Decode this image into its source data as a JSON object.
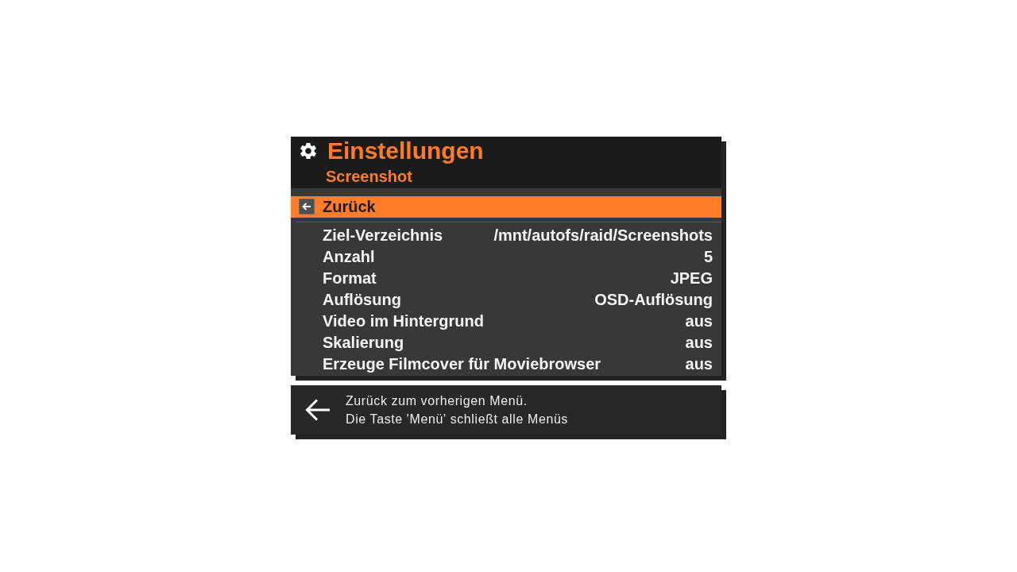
{
  "header": {
    "title": "Einstellungen",
    "subtitle": "Screenshot"
  },
  "menu": {
    "items": [
      {
        "kind": "back",
        "label": "Zurück",
        "selected": true
      },
      {
        "kind": "setting",
        "label": "Ziel-Verzeichnis",
        "value": "/mnt/autofs/raid/Screenshots",
        "selected": false
      },
      {
        "kind": "setting",
        "label": "Anzahl",
        "value": "5",
        "selected": false
      },
      {
        "kind": "setting",
        "label": "Format",
        "value": "JPEG",
        "selected": false
      },
      {
        "kind": "setting",
        "label": "Auflösung",
        "value": "OSD-Auflösung",
        "selected": false
      },
      {
        "kind": "setting",
        "label": "Video im Hintergrund",
        "value": "aus",
        "selected": false
      },
      {
        "kind": "setting",
        "label": "Skalierung",
        "value": "aus",
        "selected": false
      },
      {
        "kind": "setting",
        "label": "Erzeuge Filmcover für Moviebrowser",
        "value": "aus",
        "selected": false
      }
    ]
  },
  "help": {
    "lines": [
      "Zurück zum vorherigen Menü.",
      "Die Taste 'Menü' schließt alle Menüs"
    ]
  }
}
